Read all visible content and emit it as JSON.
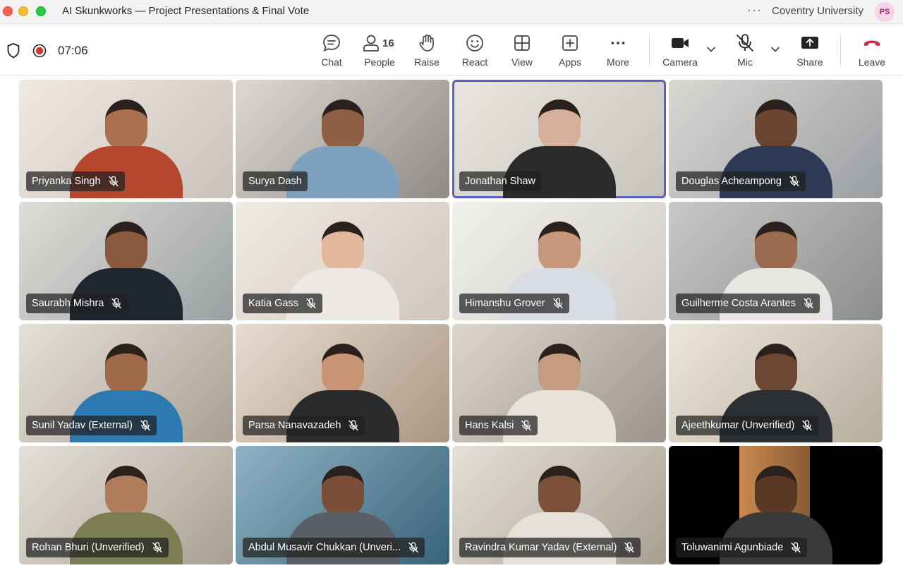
{
  "window": {
    "title": "AI Skunkworks — Project Presentations & Final Vote",
    "more_label": "···",
    "org": "Coventry University",
    "avatar_initials": "PS"
  },
  "meeting": {
    "timer": "07:06",
    "recording_color": "#d13438",
    "accent": "#5b5fc7"
  },
  "toolbar": {
    "chat": {
      "label": "Chat",
      "icon": "chat-icon"
    },
    "people": {
      "label": "People",
      "count": "16",
      "icon": "people-icon"
    },
    "raise": {
      "label": "Raise",
      "icon": "hand-icon"
    },
    "react": {
      "label": "React",
      "icon": "smile-icon"
    },
    "view": {
      "label": "View",
      "icon": "grid-icon"
    },
    "apps": {
      "label": "Apps",
      "icon": "plus-icon"
    },
    "more": {
      "label": "More",
      "icon": "more-icon"
    },
    "camera": {
      "label": "Camera",
      "icon": "camera-icon"
    },
    "mic": {
      "label": "Mic",
      "icon": "mic-off-icon"
    },
    "share": {
      "label": "Share",
      "icon": "share-icon"
    },
    "leave": {
      "label": "Leave",
      "icon": "hangup-icon",
      "color": "#c4314b"
    }
  },
  "participants": [
    {
      "name": "Priyanka Singh",
      "muted": true,
      "active": false
    },
    {
      "name": "Surya Dash",
      "muted": false,
      "active": false
    },
    {
      "name": "Jonathan Shaw",
      "muted": false,
      "active": true
    },
    {
      "name": "Douglas Acheampong",
      "muted": true,
      "active": false
    },
    {
      "name": "Saurabh Mishra",
      "muted": true,
      "active": false
    },
    {
      "name": "Katia Gass",
      "muted": true,
      "active": false
    },
    {
      "name": "Himanshu Grover",
      "muted": true,
      "active": false
    },
    {
      "name": "Guilherme Costa Arantes",
      "muted": true,
      "active": false
    },
    {
      "name": "Sunil Yadav (External)",
      "muted": true,
      "active": false
    },
    {
      "name": "Parsa Nanavazadeh",
      "muted": true,
      "active": false
    },
    {
      "name": "Hans Kalsi",
      "muted": true,
      "active": false
    },
    {
      "name": "Ajeethkumar (Unverified)",
      "muted": true,
      "active": false
    },
    {
      "name": "Rohan Bhuri (Unverified)",
      "muted": true,
      "active": false
    },
    {
      "name": "Abdul Musavir Chukkan (Unveri...",
      "muted": true,
      "active": false
    },
    {
      "name": "Ravindra Kumar Yadav (External)",
      "muted": true,
      "active": false
    },
    {
      "name": "Toluwanimi Agunbiade",
      "muted": true,
      "active": false
    }
  ]
}
